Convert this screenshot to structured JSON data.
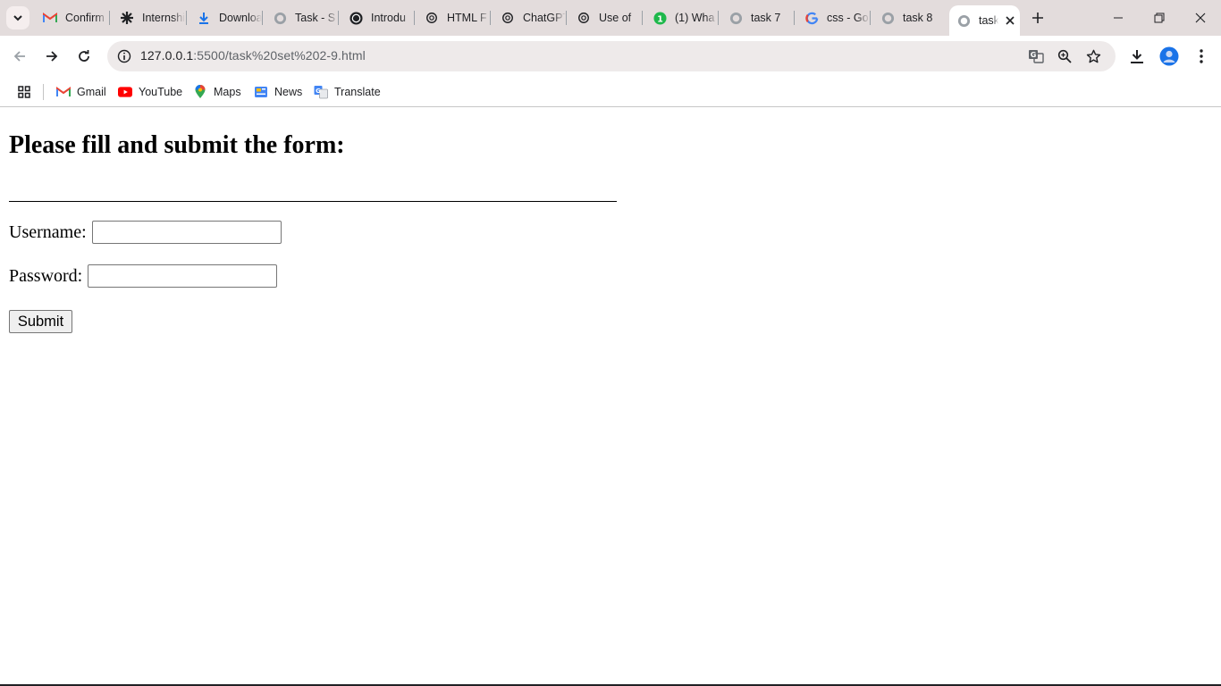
{
  "browser": {
    "tabs": [
      {
        "title": "Confirm",
        "icon": "gmail-icon"
      },
      {
        "title": "Internship",
        "icon": "spark-icon"
      },
      {
        "title": "Downloads",
        "icon": "download-icon"
      },
      {
        "title": "Task - S",
        "icon": "globe-icon"
      },
      {
        "title": "Introdu",
        "icon": "openai-icon"
      },
      {
        "title": "HTML F",
        "icon": "openai-icon"
      },
      {
        "title": "ChatGPT",
        "icon": "openai-icon"
      },
      {
        "title": "Use of",
        "icon": "openai-icon"
      },
      {
        "title": "(1) Wha",
        "icon": "whatsapp-icon"
      },
      {
        "title": "task 7",
        "icon": "globe-icon"
      },
      {
        "title": "css - Go",
        "icon": "google-icon"
      },
      {
        "title": "task 8",
        "icon": "globe-icon"
      }
    ],
    "active_tab": {
      "title": "task",
      "icon": "globe-icon"
    },
    "url": {
      "host": "127.0.0.1",
      "rest": ":5500/task%20set%202-9.html"
    },
    "bookmarks": [
      {
        "label": "Gmail",
        "icon": "gmail-icon"
      },
      {
        "label": "YouTube",
        "icon": "youtube-icon"
      },
      {
        "label": "Maps",
        "icon": "maps-icon"
      },
      {
        "label": "News",
        "icon": "news-icon"
      },
      {
        "label": "Translate",
        "icon": "translate-icon"
      }
    ]
  },
  "page": {
    "heading": "Please fill and submit the form:",
    "username_label": "Username:",
    "username_value": "",
    "password_label": "Password:",
    "password_value": "",
    "submit_label": "Submit"
  },
  "colors": {
    "tabstrip_bg": "#e3dcdc",
    "omnibox_bg": "#eeeaea",
    "accent_blue": "#1a73e8"
  }
}
